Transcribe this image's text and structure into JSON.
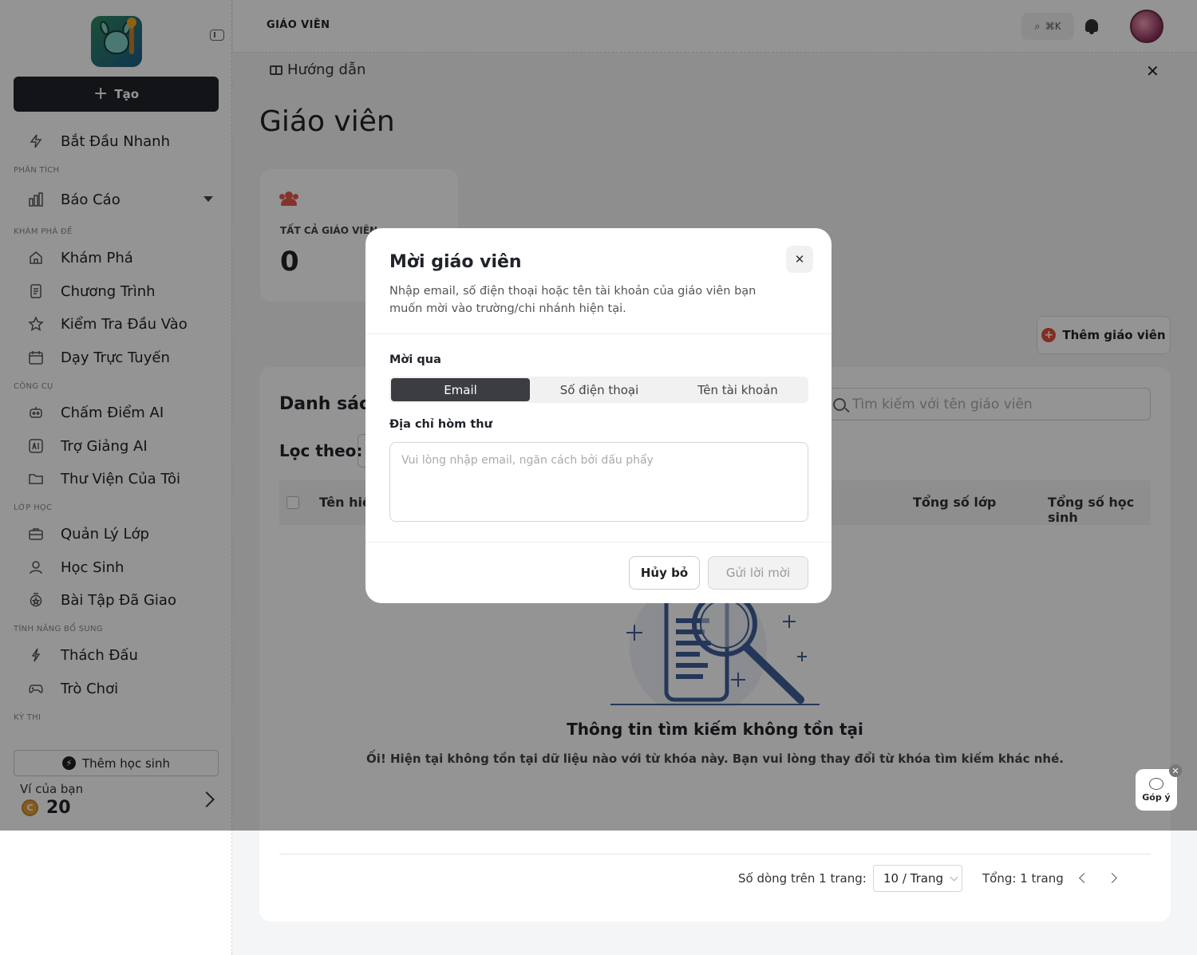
{
  "sidebar": {
    "create_label": "Tạo",
    "quick_start": "Bắt Đầu Nhanh",
    "sections": {
      "analytics": "PHÂN TÍCH",
      "explore": "KHÁM PHÁ ĐỀ",
      "tools": "CÔNG CỤ",
      "class": "LỚP HỌC",
      "extras": "TÍNH NĂNG BỔ SUNG",
      "exam": "KỲ THI"
    },
    "items": {
      "report": "Báo Cáo",
      "explore": "Khám Phá",
      "program": "Chương Trình",
      "placement": "Kiểm Tra Đầu Vào",
      "online": "Dạy Trực Tuyến",
      "ai_grading": "Chấm Điểm AI",
      "ai_assistant": "Trợ Giảng AI",
      "library": "Thư Viện Của Tôi",
      "class_mgmt": "Quản Lý Lớp",
      "students": "Học Sinh",
      "assigned": "Bài Tập Đã Giao",
      "challenge": "Thách Đấu",
      "games": "Trò Chơi"
    },
    "add_student": "Thêm học sinh",
    "wallet_label": "Ví của bạn",
    "wallet_amount": "20",
    "coin_glyph": "C"
  },
  "topbar": {
    "title": "GIÁO VIÊN",
    "shortcut": "⌘K"
  },
  "guide": {
    "label": "Hướng dẫn",
    "close": "✕"
  },
  "page": {
    "title": "Giáo viên",
    "stat_label": "TẤT CẢ GIÁO VIÊN",
    "stat_value": "0",
    "add_teacher": "Thêm giáo viên",
    "add_teacher_icon": "+",
    "list_title": "Danh sách",
    "filter_label": "Lọc theo:",
    "search_placeholder": "Tìm kiếm với tên giáo viên",
    "columns": {
      "name": "Tên hiển",
      "classes": "Tổng số lớp",
      "students": "Tổng số học sinh"
    },
    "empty_title": "Thông tin tìm kiếm không tồn tại",
    "empty_sub": "Ối! Hiện tại không tồn tại dữ liệu nào với từ khóa này. Bạn vui lòng thay đổi từ khóa tìm kiếm khác nhé.",
    "rows_per_page_label": "Số dòng trên 1 trang:",
    "rows_per_page_value": "10 / Trang",
    "total_pages": "Tổng: 1 trang"
  },
  "feedback": {
    "label": "Góp ý",
    "close": "✕"
  },
  "modal": {
    "title": "Mời giáo viên",
    "close": "✕",
    "description": "Nhập email, số điện thoại hoặc tên tài khoản của giáo viên bạn muốn mời vào trường/chi nhánh hiện tại.",
    "invite_via": "Mời qua",
    "tabs": [
      "Email",
      "Số điện thoại",
      "Tên tài khoản"
    ],
    "active_tab": "Email",
    "address_label": "Địa chỉ hòm thư",
    "address_placeholder": "Vui lòng nhập email, ngăn cách bởi dấu phẩy",
    "address_value": "",
    "cancel": "Hủy bỏ",
    "send": "Gửi lời mời"
  },
  "colors": {
    "primary_dark": "#1f2329",
    "accent_red": "#e54d3b",
    "illustration_blue": "#3e5f9a"
  }
}
